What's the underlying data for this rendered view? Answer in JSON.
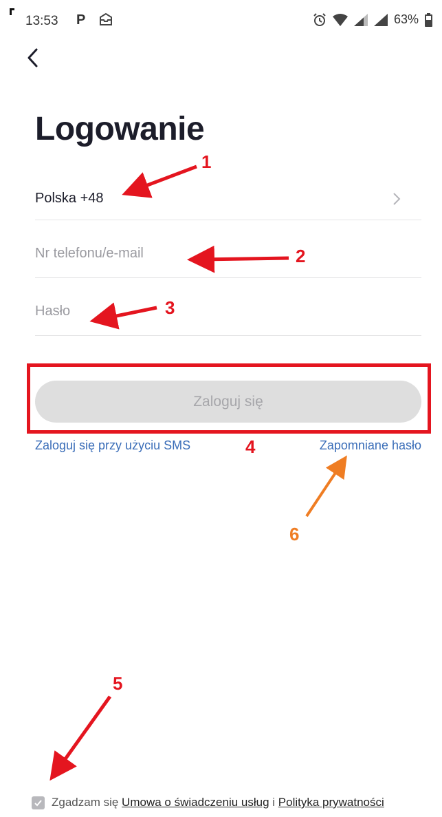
{
  "status_bar": {
    "time": "13:53",
    "app_letter": "P",
    "battery_percent": "63%"
  },
  "login": {
    "title": "Logowanie",
    "country": "Polska +48",
    "phone_placeholder": "Nr telefonu/e-mail",
    "password_placeholder": "Hasło",
    "login_button": "Zaloguj się",
    "sms_link": "Zaloguj się przy użyciu SMS",
    "forgot_link": "Zapomniane hasło"
  },
  "agreement": {
    "checked": true,
    "prefix": "Zgadzam się ",
    "terms_link": "Umowa o świadczeniu usług",
    "and": " i ",
    "privacy_link": "Polityka prywatności"
  },
  "annotations": {
    "labels": [
      "1",
      "2",
      "3",
      "4",
      "5",
      "6"
    ],
    "red_color": "#e4151f",
    "orange_color": "#ef7d23"
  },
  "colors": {
    "link": "#3a6db8",
    "button_bg": "#dedede",
    "button_text": "#a6a6aa"
  }
}
